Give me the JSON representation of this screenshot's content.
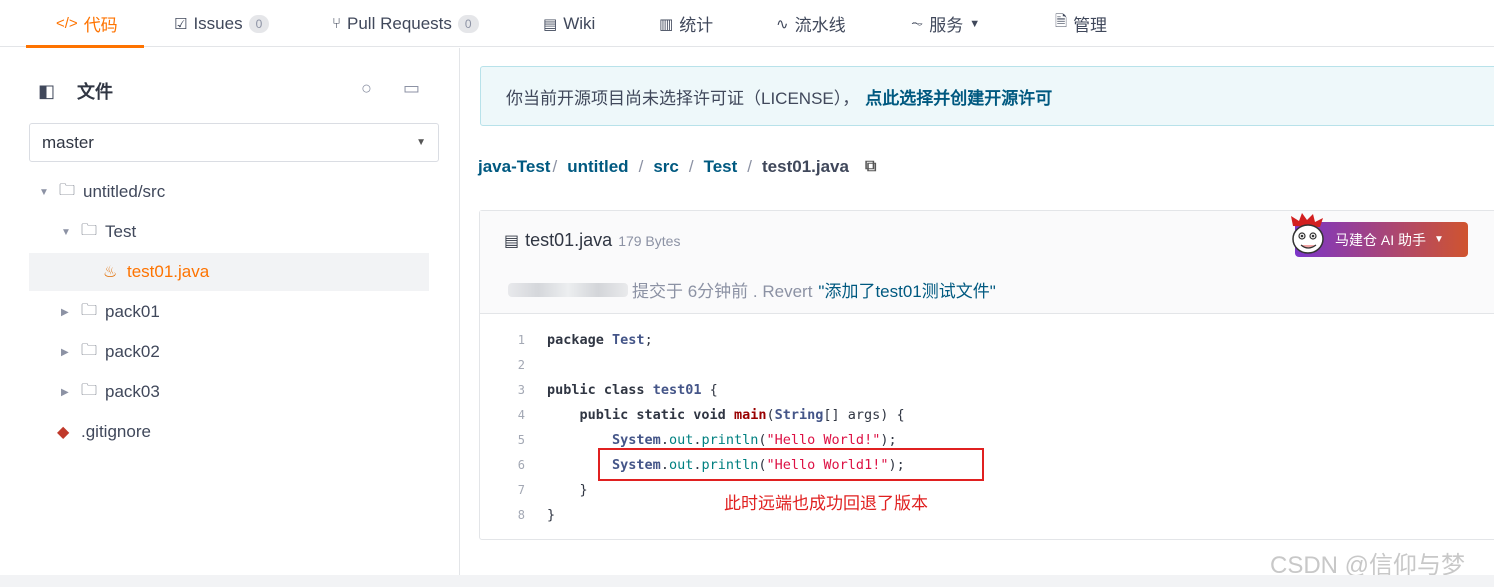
{
  "nav": {
    "tabs": [
      {
        "label": "代码",
        "icon": "code-icon",
        "active": true
      },
      {
        "label": "Issues",
        "icon": "issues-icon",
        "badge": "0"
      },
      {
        "label": "Pull Requests",
        "icon": "pull-request-icon",
        "badge": "0"
      },
      {
        "label": "Wiki",
        "icon": "wiki-icon"
      },
      {
        "label": "统计",
        "icon": "stats-icon"
      },
      {
        "label": "流水线",
        "icon": "pipeline-icon"
      },
      {
        "label": "服务",
        "icon": "service-icon"
      },
      {
        "label": "管理",
        "icon": "manage-icon"
      }
    ]
  },
  "sidebar": {
    "title": "文件",
    "branch": "master",
    "tree": [
      {
        "label": "untitled/src",
        "type": "folder",
        "expanded": true
      },
      {
        "label": "Test",
        "type": "folder",
        "expanded": true
      },
      {
        "label": "test01.java",
        "type": "file",
        "selected": true
      },
      {
        "label": "pack01",
        "type": "folder"
      },
      {
        "label": "pack02",
        "type": "folder"
      },
      {
        "label": "pack03",
        "type": "folder"
      },
      {
        "label": ".gitignore",
        "type": "git-file"
      }
    ]
  },
  "license": {
    "text": "你当前开源项目尚未选择许可证（LICENSE），",
    "link": "点此选择并创建开源许可"
  },
  "breadcrumb": {
    "parts": [
      "java-Test",
      "untitled",
      "src",
      "Test"
    ],
    "current": "test01.java"
  },
  "file": {
    "name": "test01.java",
    "size": "179 Bytes",
    "ai_button": "马建仓 AI 助手",
    "commit_text": "提交于 6分钟前 . Revert",
    "commit_msg": "\"添加了test01测试文件\""
  },
  "code": {
    "line_numbers": [
      "1",
      "2",
      "3",
      "4",
      "5",
      "6",
      "7",
      "8"
    ]
  },
  "annotation": "此时远端也成功回退了版本",
  "watermark": "CSDN @信仰与梦",
  "colors": {
    "accent": "#fe7300",
    "link": "#005980",
    "annotation": "#e02020"
  }
}
